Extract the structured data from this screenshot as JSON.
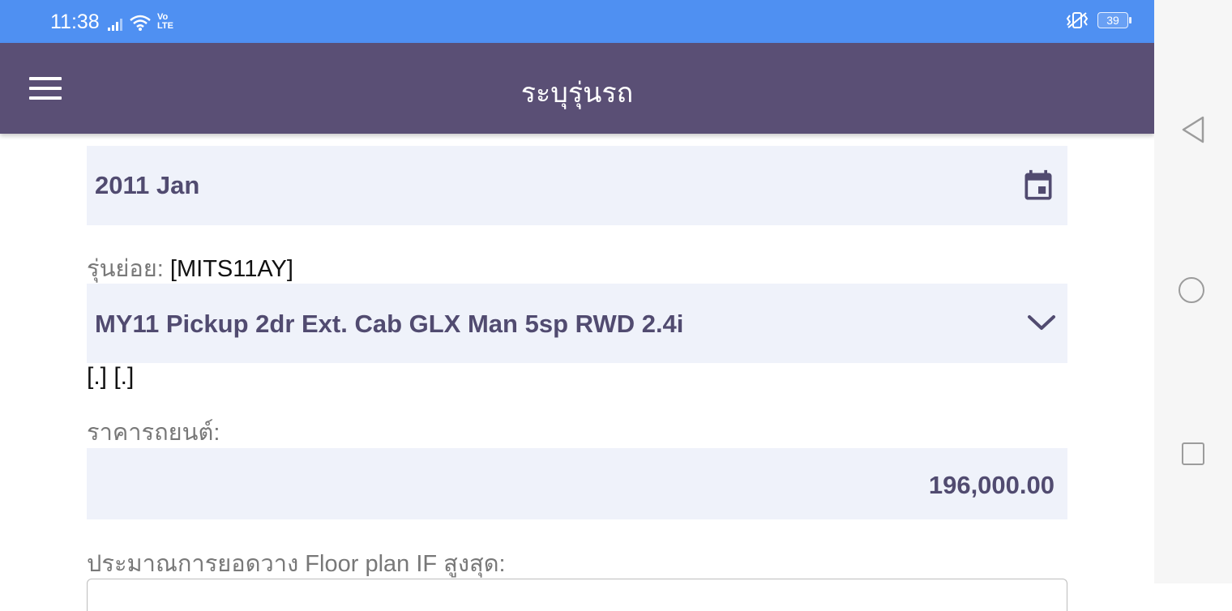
{
  "status_bar": {
    "time": "11:38",
    "network_label": "Vo LTE",
    "battery": "39",
    "icons": [
      "signal-icon",
      "wifi-icon",
      "volte-icon",
      "vibrate-icon",
      "battery-icon"
    ]
  },
  "app_bar": {
    "title": "ระบุรุ่นรถ",
    "menu_icon": "hamburger-menu-icon"
  },
  "form": {
    "date": {
      "value": "2011 Jan",
      "icon": "calendar-icon"
    },
    "submodel": {
      "label": "รุ่นย่อย: ",
      "code": "[MITS11AY]"
    },
    "model_select": {
      "value": "MY11 Pickup 2dr Ext. Cab GLX Man 5sp RWD 2.4i",
      "icon": "chevron-down-icon"
    },
    "extra_text": "[.] [.]",
    "price": {
      "label": "ราคารถยนต์:",
      "value": "196,000.00"
    },
    "floor_plan": {
      "label": "ประมาณการยอดวาง Floor plan IF สูงสุด:"
    }
  },
  "nav_bar": {
    "icons": [
      "back-icon",
      "home-icon",
      "recents-icon"
    ]
  },
  "colors": {
    "status_bar": "#4f90f2",
    "app_bar": "#5a4f75",
    "field_bg": "#eff2fa",
    "field_text": "#514b70"
  }
}
